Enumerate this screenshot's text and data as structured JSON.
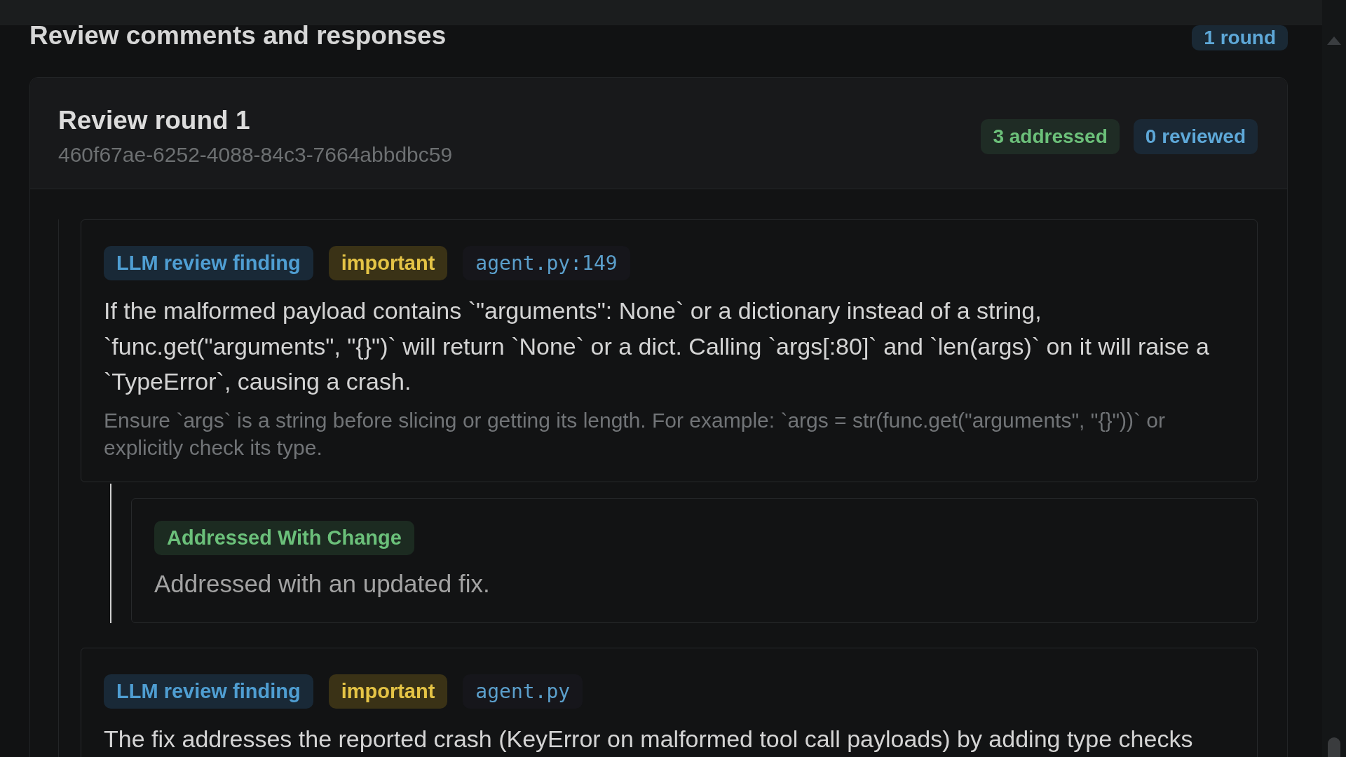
{
  "section": {
    "title": "Review comments and responses",
    "round_count": "1 round"
  },
  "rounds": [
    {
      "title": "Review round 1",
      "id": "460f67ae-6252-4088-84c3-7664abbdbc59",
      "badges": [
        {
          "label": "3 addressed",
          "kind": "addressed"
        },
        {
          "label": "0 reviewed",
          "kind": "reviewed"
        }
      ],
      "findings": [
        {
          "tags": [
            {
              "label": "LLM review finding",
              "kind": "source"
            },
            {
              "label": "important",
              "kind": "severity"
            },
            {
              "label": "agent.py:149",
              "kind": "location"
            }
          ],
          "text": "If the malformed payload contains `\"arguments\": None` or a dictionary instead of a string, `func.get(\"arguments\", \"{}\")` will return `None` or a dict. Calling `args[:80]` and `len(args)` on it will raise a `TypeError`, causing a crash.",
          "suggestion": "Ensure `args` is a string before slicing or getting its length. For example: `args = str(func.get(\"arguments\", \"{}\"))` or explicitly check its type.",
          "responses": [
            {
              "status": "Addressed With Change",
              "kind": "addressed",
              "text": "Addressed with an updated fix."
            }
          ]
        },
        {
          "tags": [
            {
              "label": "LLM review finding",
              "kind": "source"
            },
            {
              "label": "important",
              "kind": "severity"
            },
            {
              "label": "agent.py",
              "kind": "location"
            }
          ],
          "text": "The fix addresses the reported crash (KeyError on malformed tool call payloads) by adding type checks"
        }
      ]
    }
  ]
}
